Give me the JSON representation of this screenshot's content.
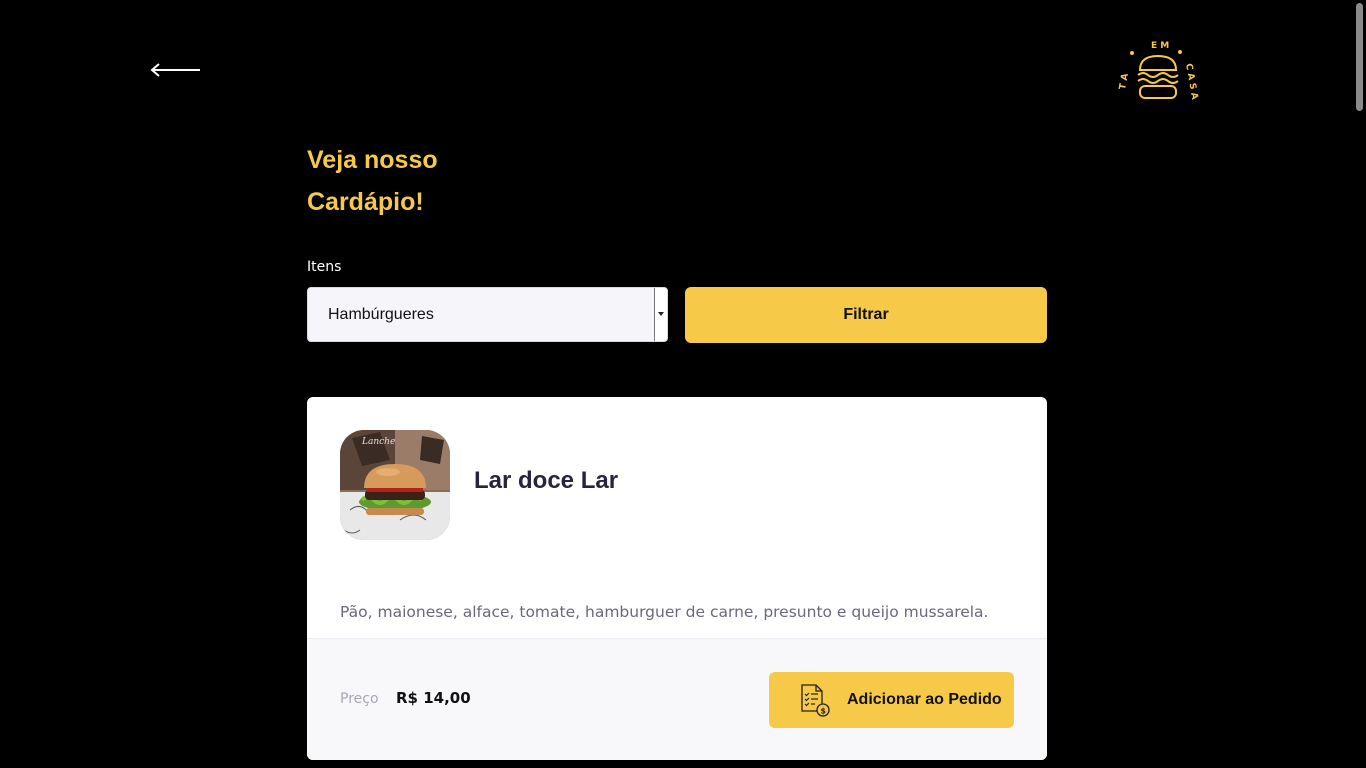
{
  "header": {
    "logo_text": "TA EM CASA"
  },
  "page": {
    "title_line1": "Veja nosso",
    "title_line2": "Cardápio!"
  },
  "filter": {
    "label": "Itens",
    "selected": "Hambúrgueres",
    "button_label": "Filtrar"
  },
  "items": [
    {
      "name": "Lar doce Lar",
      "description": "Pão, maionese, alface, tomate, hamburguer de carne, presunto e queijo mussarela.",
      "price_label": "Preço",
      "price": "R$ 14,00",
      "add_label": "Adicionar ao Pedido"
    }
  ],
  "colors": {
    "accent": "#f7c948",
    "background": "#000000",
    "card": "#ffffff",
    "title_text": "#29243d"
  }
}
